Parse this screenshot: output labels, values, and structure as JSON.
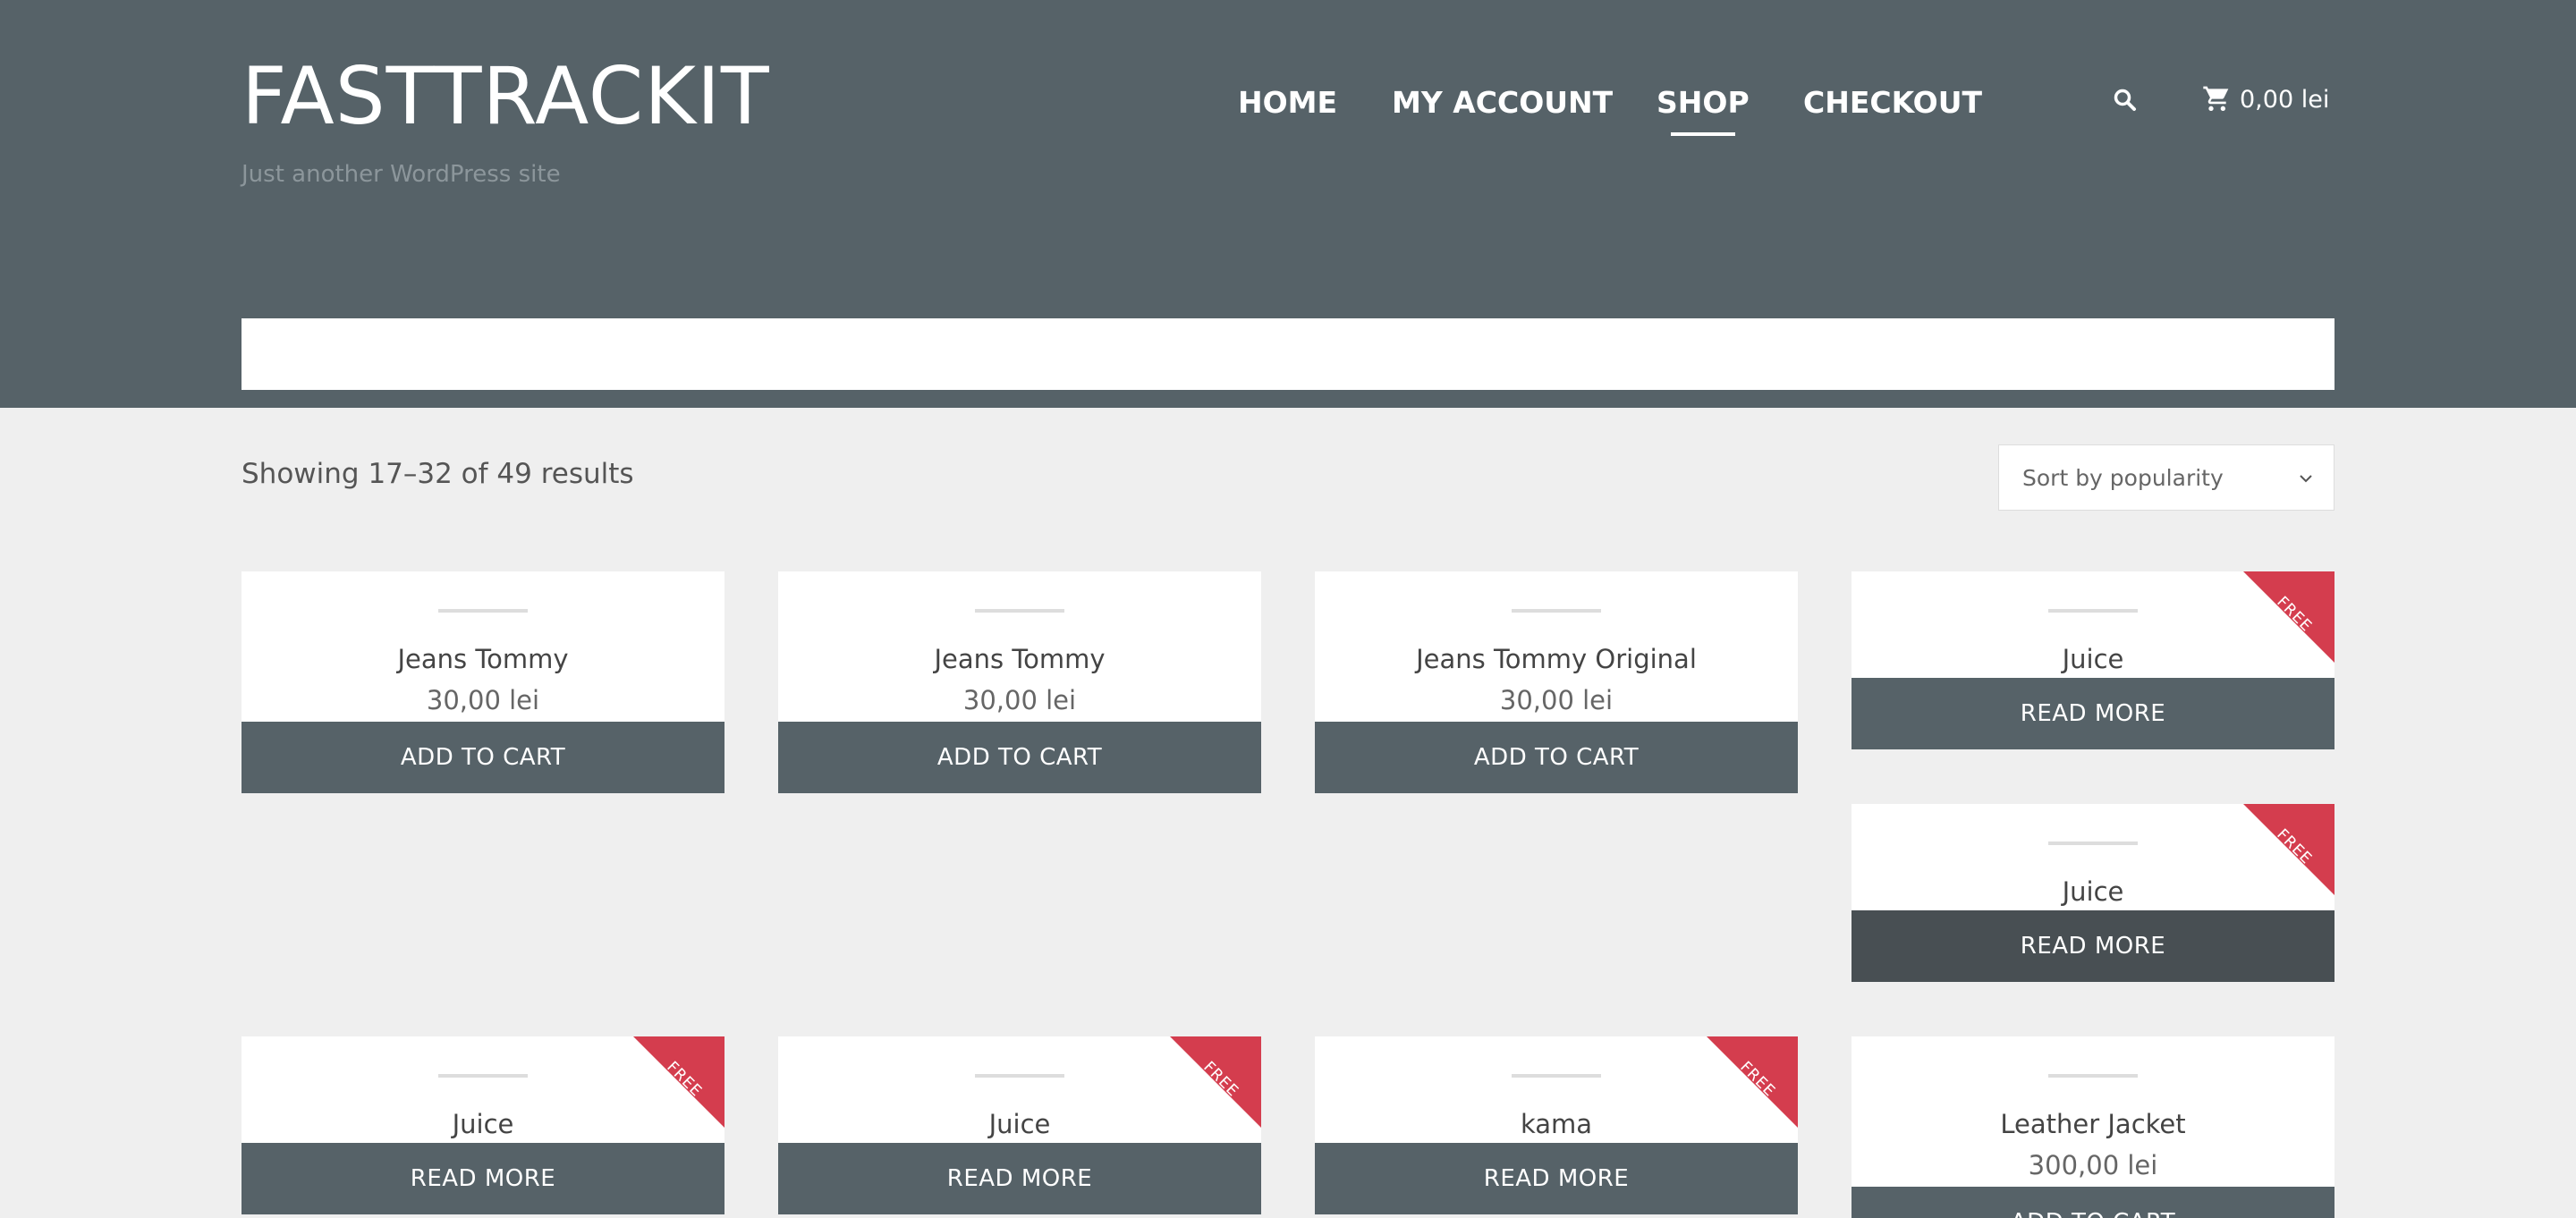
{
  "header": {
    "brand": "FASTTRACKIT",
    "tagline": "Just another WordPress site",
    "nav": [
      {
        "label": "HOME",
        "active": false
      },
      {
        "label": "MY ACCOUNT",
        "active": false
      },
      {
        "label": "SHOP",
        "active": true
      },
      {
        "label": "CHECKOUT",
        "active": false
      }
    ],
    "search_icon": "search-icon",
    "cart": {
      "icon": "cart-icon",
      "total": "0,00 lei"
    }
  },
  "shop": {
    "result_count": "Showing 17–32 of 49 results",
    "sort": {
      "selected": "Sort by popularity"
    }
  },
  "products": [
    {
      "title": "Jeans Tommy",
      "price": "30,00 lei",
      "button": "ADD TO CART",
      "badge": ""
    },
    {
      "title": "Jeans Tommy",
      "price": "30,00 lei",
      "button": "ADD TO CART",
      "badge": ""
    },
    {
      "title": "Jeans Tommy Original",
      "price": "30,00 lei",
      "button": "ADD TO CART",
      "badge": ""
    },
    {
      "title": "Juice",
      "price": "",
      "button": "READ MORE",
      "badge": "FREE"
    },
    {
      "title": "Juice",
      "price": "",
      "button": "READ MORE",
      "badge": "FREE"
    },
    {
      "title": "Juice",
      "price": "",
      "button": "READ MORE",
      "badge": "FREE"
    },
    {
      "title": "Juice",
      "price": "",
      "button": "READ MORE",
      "badge": "FREE"
    },
    {
      "title": "kama",
      "price": "",
      "button": "READ MORE",
      "badge": "FREE"
    },
    {
      "title": "Leather Jacket",
      "price": "300,00 lei",
      "button": "ADD TO CART",
      "badge": ""
    }
  ],
  "colors": {
    "header_bg": "#566268",
    "page_bg": "#efefef",
    "button_bg": "#566268",
    "button_hover_bg": "#484f53",
    "ribbon": "#d43d4e"
  }
}
